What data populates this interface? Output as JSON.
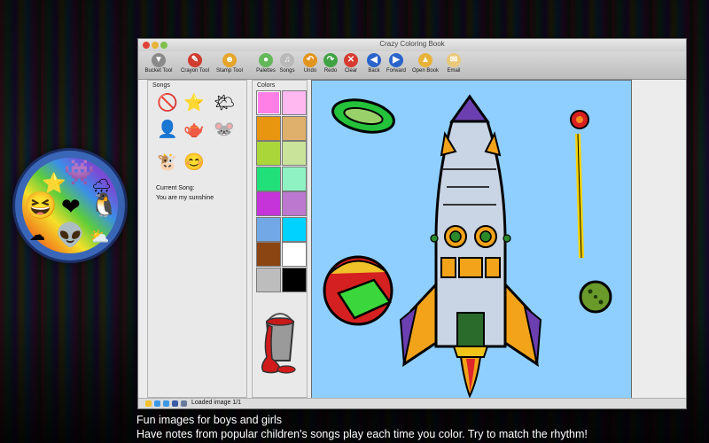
{
  "window": {
    "title": "Crazy Coloring Book"
  },
  "toolbar": [
    {
      "label": "Bucket Tool",
      "icon": "bucket-icon",
      "color": "#8a8a8a",
      "glyph": "▼"
    },
    {
      "label": "Crayon Tool",
      "icon": "crayon-icon",
      "color": "#d03c2e",
      "glyph": "✎"
    },
    {
      "label": "Stamp Tool",
      "icon": "stamp-icon",
      "color": "#e5a52a",
      "glyph": "☻"
    },
    {
      "label": "Palettes",
      "icon": "palette-icon",
      "color": "#63b85a",
      "glyph": "●"
    },
    {
      "label": "Songs",
      "icon": "music-note-icon",
      "color": "#b9b9b9",
      "glyph": "♫"
    },
    {
      "label": "Undo",
      "icon": "undo-icon",
      "color": "#e2951e",
      "glyph": "↶"
    },
    {
      "label": "Redo",
      "icon": "redo-icon",
      "color": "#3fa344",
      "glyph": "↷"
    },
    {
      "label": "Clear",
      "icon": "clear-x-icon",
      "color": "#d63a2e",
      "glyph": "✕"
    },
    {
      "label": "Back",
      "icon": "back-arrow-icon",
      "color": "#2a63c9",
      "glyph": "◀"
    },
    {
      "label": "Forward",
      "icon": "forward-arrow-icon",
      "color": "#2a63c9",
      "glyph": "▶"
    },
    {
      "label": "Open Book",
      "icon": "open-book-icon",
      "color": "#e8b23a",
      "glyph": "▲"
    },
    {
      "label": "Email",
      "icon": "email-icon",
      "color": "#e9c97a",
      "glyph": "✉"
    }
  ],
  "songs_panel": {
    "title": "Songs",
    "icons": [
      "no-song-icon",
      "star-icon",
      "sun-cloud-icon",
      "person-icon",
      "teapot-icon",
      "mouse-icon",
      "cow-icon",
      "smiley-icon"
    ],
    "current_label": "Current Song:",
    "current_song": "You are my sunshine"
  },
  "colors_panel": {
    "title": "Colors",
    "swatches": [
      "#ff7fe6",
      "#ffb8f0",
      "#e8950f",
      "#deb06b",
      "#abd63a",
      "#c9e49a",
      "#21e07a",
      "#8ff2c3",
      "#c434d9",
      "#bc77cf",
      "#72a8e6",
      "#00d2ff",
      "#8a4513",
      "#ffffff",
      "#bdbdbd",
      "#000000"
    ]
  },
  "status": {
    "text": "Loaded image 1/1"
  },
  "captions": [
    "Fun images for boys and girls",
    "Have notes from popular children's songs play each time you color.  Try to match the rhythm!"
  ]
}
